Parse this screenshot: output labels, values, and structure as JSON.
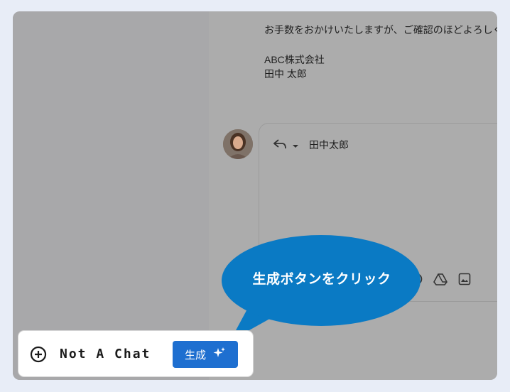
{
  "email": {
    "lines": [
      "お手数をおかけいたしますが、ご確認のほどよろしく",
      "ABC株式会社",
      "田中 太郎"
    ]
  },
  "reply": {
    "recipient": "田中太郎",
    "icons": [
      "emoji-icon",
      "drive-icon",
      "image-icon"
    ]
  },
  "callout": {
    "text": "生成ボタンをクリック"
  },
  "not_a_chat": {
    "title": "Not A Chat",
    "generate_label": "生成"
  },
  "colors": {
    "callout_fill": "#0a7ac4",
    "generate_button": "#1e6fd0",
    "overlay": "#a9a9aa"
  }
}
